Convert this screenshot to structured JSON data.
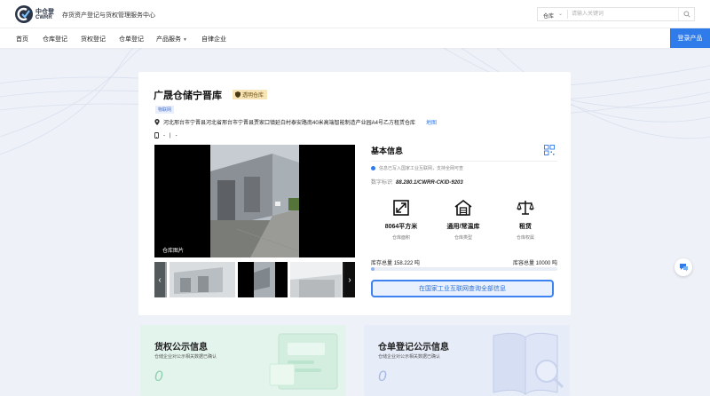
{
  "header": {
    "logo_cn": "中仓登",
    "logo_en": "CWRR",
    "site_title": "存货资产登记与货权管理服务中心",
    "search": {
      "type_label": "仓库",
      "placeholder": "请输入关键词"
    }
  },
  "nav": {
    "items": [
      {
        "label": "首页"
      },
      {
        "label": "仓库登记"
      },
      {
        "label": "货权登记"
      },
      {
        "label": "仓单登记"
      },
      {
        "label": "产品服务"
      },
      {
        "label": "自律企业"
      }
    ],
    "login_label": "登录产品"
  },
  "warehouse": {
    "name": "广晟仓储宁晋库",
    "badge": "透明仓库",
    "tag": "物联网",
    "address": "河北邢台市宁晋县河北省邢台市宁晋县贾家口镇延白村泰安路南40米高端智能制造产业园A4号乙方租赁仓库",
    "map_link": "地图",
    "phone": "-",
    "phone_sep": "|",
    "phone_extra": "-",
    "photo_caption": "仓库图片"
  },
  "basic_info": {
    "title": "基本信息",
    "notice": "信息已写入国家工业互联网，支持全网可查",
    "digital_id_label": "数字标识",
    "digital_id": "88.280.1/CWRR-CKID-9203",
    "stats": [
      {
        "icon": "area-icon",
        "value": "8064平方米",
        "label": "仓库面积"
      },
      {
        "icon": "warehouse-icon",
        "value": "通用/常温库",
        "label": "仓库类型"
      },
      {
        "icon": "scale-icon",
        "value": "租赁",
        "label": "仓库权属"
      }
    ],
    "stock_total_label": "库存总量",
    "stock_total": "158.222 吨",
    "capacity_total_label": "库容总量",
    "capacity_total": "10000 吨",
    "usage_fraction": 0.0158,
    "query_button": "在国家工业互联网查询全部信息"
  },
  "panels": [
    {
      "title": "货权公示信息",
      "subtitle": "仓储企业对公示相关数据已确认",
      "count": "0"
    },
    {
      "title": "仓单登记公示信息",
      "subtitle": "仓储企业对公示相关数据已确认",
      "count": "0"
    }
  ],
  "colors": {
    "accent": "#2f7bea",
    "badge_bg": "#f7e5b7",
    "panel_green": "#e3f4ec",
    "panel_blue": "#e6ecf8"
  }
}
